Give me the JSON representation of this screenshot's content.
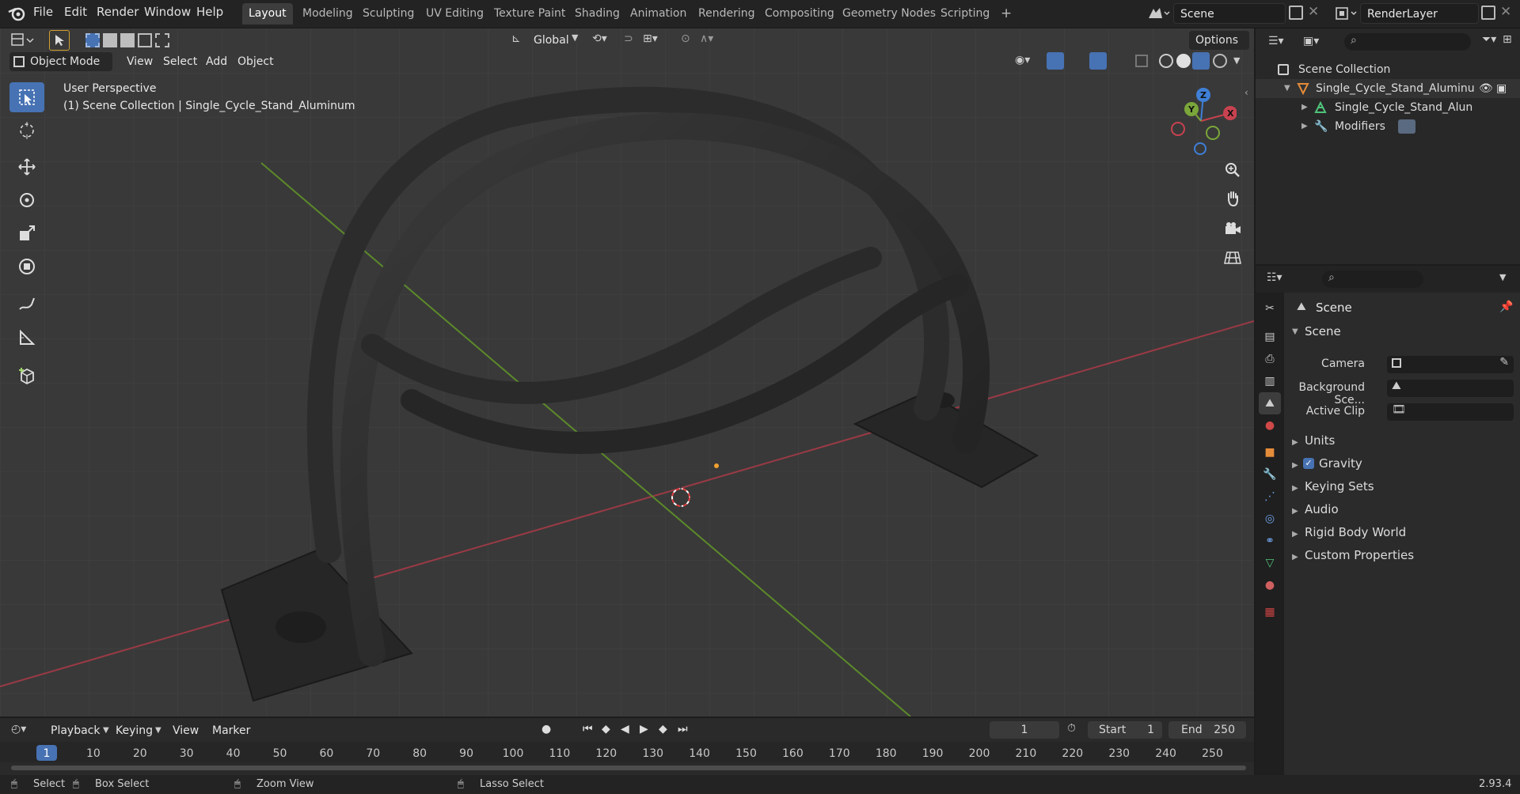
{
  "topbar": {
    "menus": [
      "File",
      "Edit",
      "Render",
      "Window",
      "Help"
    ],
    "workspaces": [
      "Layout",
      "Modeling",
      "Sculpting",
      "UV Editing",
      "Texture Paint",
      "Shading",
      "Animation",
      "Rendering",
      "Compositing",
      "Geometry Nodes",
      "Scripting"
    ],
    "active_workspace": "Layout",
    "add_tab": "+",
    "scene": "Scene",
    "view_layer": "RenderLayer"
  },
  "viewport": {
    "transform_orientation": "Global",
    "options_label": "Options",
    "mode": "Object Mode",
    "menus": [
      "View",
      "Select",
      "Add",
      "Object"
    ],
    "overlay_title": "User Perspective",
    "overlay_subtitle": "(1) Scene Collection | Single_Cycle_Stand_Aluminum",
    "gizmo_axes": {
      "x": "X",
      "y": "Y",
      "z": "Z"
    }
  },
  "outliner": {
    "root": "Scene Collection",
    "items": [
      {
        "label": "Single_Cycle_Stand_Aluminu",
        "icon": "object-icon"
      },
      {
        "label": "Single_Cycle_Stand_Alun",
        "icon": "mesh-data-icon"
      },
      {
        "label": "Modifiers",
        "icon": "wrench-icon"
      }
    ]
  },
  "properties": {
    "header": "Scene",
    "section": "Scene",
    "fields": [
      {
        "label": "Camera",
        "value": ""
      },
      {
        "label": "Background Sce...",
        "value": ""
      },
      {
        "label": "Active Clip",
        "value": ""
      }
    ],
    "panels": [
      "Units",
      "Gravity",
      "Keying Sets",
      "Audio",
      "Rigid Body World",
      "Custom Properties"
    ],
    "gravity_checked": true
  },
  "timeline": {
    "menus": [
      "Playback",
      "Keying",
      "View",
      "Marker"
    ],
    "current_frame": "1",
    "start_label": "Start",
    "start_value": "1",
    "end_label": "End",
    "end_value": "250",
    "ticks": [
      "1",
      "10",
      "20",
      "30",
      "40",
      "50",
      "60",
      "70",
      "80",
      "90",
      "100",
      "110",
      "120",
      "130",
      "140",
      "150",
      "160",
      "170",
      "180",
      "190",
      "200",
      "210",
      "220",
      "230",
      "240",
      "250"
    ]
  },
  "statusbar": {
    "select": "Select",
    "box_select": "Box Select",
    "zoom_view": "Zoom View",
    "lasso_select": "Lasso Select",
    "version": "2.93.4"
  },
  "colors": {
    "accent": "#4772b3",
    "x_axis": "#c8424f",
    "y_axis": "#7aa63a",
    "z_axis": "#3f7fd6"
  }
}
